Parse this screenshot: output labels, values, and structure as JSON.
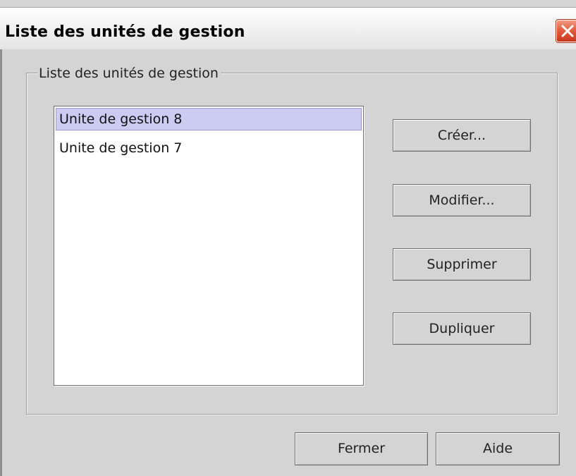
{
  "window": {
    "title": "Liste des unités de gestion",
    "close_icon": "close-icon",
    "close_color": "#d9462a"
  },
  "group": {
    "legend": "Liste des unités de gestion"
  },
  "list": {
    "items": [
      {
        "label": "Unite de gestion 8",
        "selected": true
      },
      {
        "label": "Unite de gestion 7",
        "selected": false
      }
    ],
    "selection_color": "#ccccf2"
  },
  "actions": {
    "create": "Créer...",
    "modify": "Modifier...",
    "delete": "Supprimer",
    "duplicate": "Dupliquer"
  },
  "footer": {
    "close": "Fermer",
    "help": "Aide"
  }
}
